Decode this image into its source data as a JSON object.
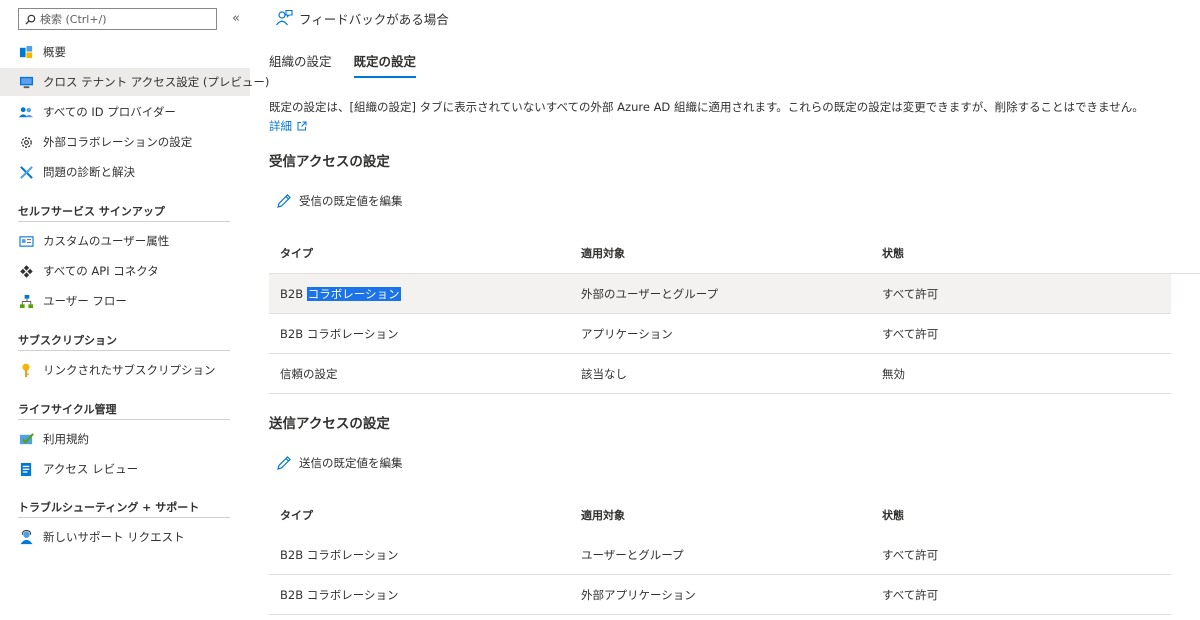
{
  "sidebar": {
    "search": {
      "placeholder": "検索 (Ctrl+/)"
    },
    "collapse": "«",
    "items_top": [
      {
        "label": "概要",
        "icon": "overview-icon"
      },
      {
        "label": "クロス テナント アクセス設定 (プレビュー)",
        "icon": "monitor-icon",
        "active": true
      },
      {
        "label": "すべての ID プロバイダー",
        "icon": "users-icon"
      },
      {
        "label": "外部コラボレーションの設定",
        "icon": "gear-icon"
      },
      {
        "label": "問題の診断と解決",
        "icon": "wrench-icon"
      }
    ],
    "sections": [
      {
        "title": "セルフサービス サインアップ",
        "items": [
          {
            "label": "カスタムのユーザー属性",
            "icon": "id-card-icon"
          },
          {
            "label": "すべての API コネクタ",
            "icon": "connector-icon"
          },
          {
            "label": "ユーザー フロー",
            "icon": "flow-icon"
          }
        ]
      },
      {
        "title": "サブスクリプション",
        "items": [
          {
            "label": "リンクされたサブスクリプション",
            "icon": "key-icon"
          }
        ]
      },
      {
        "title": "ライフサイクル管理",
        "items": [
          {
            "label": "利用規約",
            "icon": "terms-icon"
          },
          {
            "label": "アクセス レビュー",
            "icon": "review-icon"
          }
        ]
      },
      {
        "title": "トラブルシューティング + サポート",
        "items": [
          {
            "label": "新しいサポート リクエスト",
            "icon": "support-icon"
          }
        ]
      }
    ]
  },
  "main": {
    "feedback": "フィードバックがある場合",
    "tabs": [
      {
        "label": "組織の設定",
        "active": false
      },
      {
        "label": "既定の設定",
        "active": true
      }
    ],
    "description": "既定の設定は、[組織の設定] タブに表示されていないすべての外部 Azure AD 組織に適用されます。これらの既定の設定は変更できますが、削除することはできません。",
    "more_link": "詳細",
    "inbound": {
      "title": "受信アクセスの設定",
      "edit": "受信の既定値を編集",
      "headers": [
        "タイプ",
        "適用対象",
        "状態"
      ],
      "rows": [
        {
          "type_prefix": "B2B",
          "type_suffix": "コラボレーション",
          "target": "外部のユーザーとグループ",
          "status": "すべて許可"
        },
        {
          "type_prefix": "B2B",
          "type_suffix": "コラボレーション",
          "target": "アプリケーション",
          "status": "すべて許可"
        },
        {
          "type_prefix": "",
          "type_suffix": "信頼の設定",
          "target": "該当なし",
          "status": "無効"
        }
      ]
    },
    "outbound": {
      "title": "送信アクセスの設定",
      "edit": "送信の既定値を編集",
      "headers": [
        "タイプ",
        "適用対象",
        "状態"
      ],
      "rows": [
        {
          "type_prefix": "B2B",
          "type_suffix": "コラボレーション",
          "target": "ユーザーとグループ",
          "status": "すべて許可"
        },
        {
          "type_prefix": "B2B",
          "type_suffix": "コラボレーション",
          "target": "外部アプリケーション",
          "status": "すべて許可"
        }
      ]
    }
  },
  "colors": {
    "accent": "#0078d4",
    "active_bg": "#edebe9",
    "hover_row": "#f3f2f1",
    "selection": "#1a73e8"
  }
}
